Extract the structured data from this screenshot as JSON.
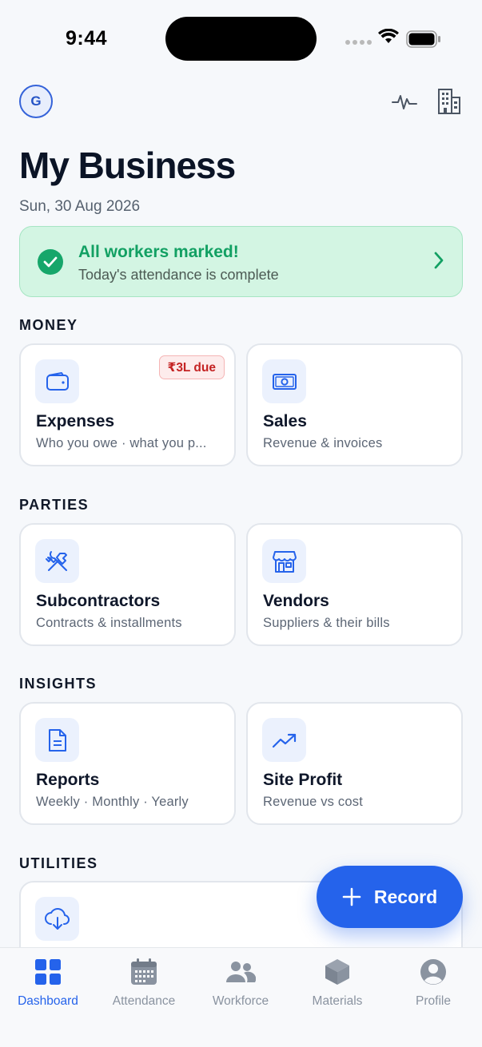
{
  "status_bar": {
    "time": "9:44"
  },
  "header": {
    "avatar_initial": "G",
    "title": "My Business",
    "date": "Sun, 30 Aug 2026",
    "icons": [
      "activity-icon",
      "building-icon"
    ]
  },
  "banner": {
    "title": "All workers marked!",
    "subtitle": "Today's attendance is complete"
  },
  "sections": {
    "money": {
      "label": "MONEY",
      "cards": [
        {
          "title": "Expenses",
          "subtitle": "Who you owe · what you p...",
          "badge": "₹3L due",
          "icon": "wallet-icon"
        },
        {
          "title": "Sales",
          "subtitle": "Revenue & invoices",
          "icon": "cash-icon"
        }
      ]
    },
    "parties": {
      "label": "PARTIES",
      "cards": [
        {
          "title": "Subcontractors",
          "subtitle": "Contracts & installments",
          "icon": "tools-icon"
        },
        {
          "title": "Vendors",
          "subtitle": "Suppliers & their bills",
          "icon": "store-icon"
        }
      ]
    },
    "insights": {
      "label": "INSIGHTS",
      "cards": [
        {
          "title": "Reports",
          "subtitle": "Weekly · Monthly · Yearly",
          "icon": "document-icon"
        },
        {
          "title": "Site Profit",
          "subtitle": "Revenue vs cost",
          "icon": "trending-up-icon"
        }
      ]
    },
    "utilities": {
      "label": "UTILITIES",
      "cards": [
        {
          "icon": "cloud-download-icon"
        }
      ]
    }
  },
  "fab": {
    "label": "Record",
    "icon": "plus-icon"
  },
  "bottom_nav": {
    "active": "Dashboard",
    "items": [
      {
        "label": "Dashboard",
        "icon": "grid-icon"
      },
      {
        "label": "Attendance",
        "icon": "calendar-icon"
      },
      {
        "label": "Workforce",
        "icon": "people-icon"
      },
      {
        "label": "Materials",
        "icon": "box-icon"
      },
      {
        "label": "Profile",
        "icon": "user-circle-icon"
      }
    ]
  },
  "colors": {
    "accent": "#2563EB",
    "success": "#12A063",
    "success_bg": "#D3F5E3",
    "danger": "#C42323",
    "background": "#F6F8FB"
  }
}
